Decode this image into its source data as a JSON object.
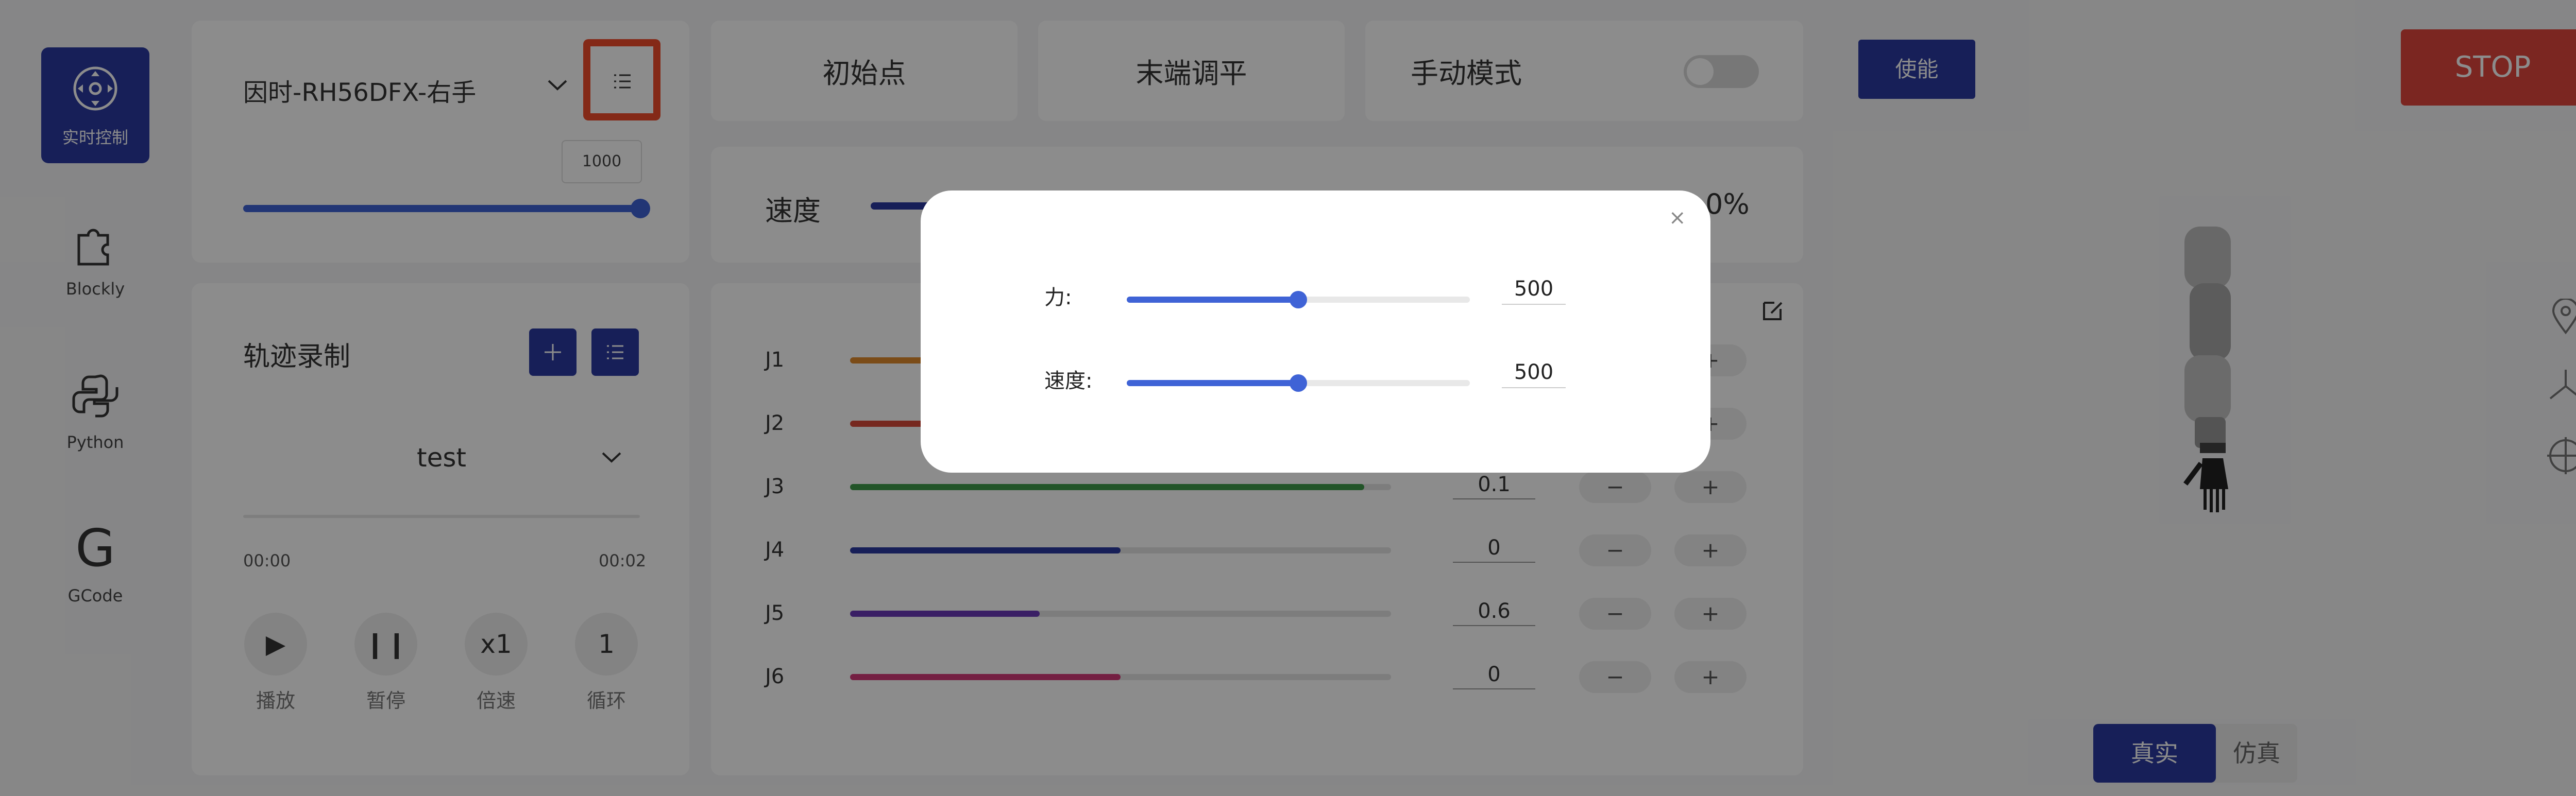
{
  "sidebar": {
    "items": [
      {
        "label": "实时控制",
        "icon": "joystick-icon",
        "active": true
      },
      {
        "label": "Blockly",
        "icon": "puzzle-icon",
        "active": false
      },
      {
        "label": "Python",
        "icon": "python-icon",
        "active": false
      },
      {
        "label": "GCode",
        "icon": "gcode-icon",
        "active": false
      }
    ]
  },
  "device": {
    "selected": "因时-RH56DFX-右手",
    "value_tooltip": "1000",
    "slider_value": 1000
  },
  "trajectory": {
    "title": "轨迹录制",
    "selected": "test",
    "time_start": "00:00",
    "time_end": "00:02",
    "controls": [
      {
        "symbol": "▶",
        "label": "播放",
        "icon": "play-icon"
      },
      {
        "symbol": "❙❙",
        "label": "暂停",
        "icon": "pause-icon"
      },
      {
        "symbol": "x1",
        "label": "倍速",
        "icon": "speed-icon"
      },
      {
        "symbol": "1",
        "label": "循环",
        "icon": "loop-icon"
      }
    ]
  },
  "tabs": {
    "initial": "初始点",
    "level": "末端调平",
    "manual": "手动模式",
    "manual_on": false
  },
  "speed": {
    "label": "速度",
    "percent_text": "0%"
  },
  "joints": [
    {
      "name": "J1",
      "color": "#e08a2c",
      "fill": 0.45,
      "value": ""
    },
    {
      "name": "J2",
      "color": "#d84a3a",
      "fill": 0.4,
      "value": ""
    },
    {
      "name": "J3",
      "color": "#3f9a4a",
      "fill": 0.95,
      "value": "0.1"
    },
    {
      "name": "J4",
      "color": "#2a3aa0",
      "fill": 0.5,
      "value": "0"
    },
    {
      "name": "J5",
      "color": "#6a3ab8",
      "fill": 0.35,
      "value": "0.6"
    },
    {
      "name": "J6",
      "color": "#d43a78",
      "fill": 0.5,
      "value": "0"
    }
  ],
  "joint_buttons": {
    "minus": "−",
    "plus": "+"
  },
  "right": {
    "enable": "使能",
    "stop": "STOP",
    "mode_real": "真实",
    "mode_sim": "仿真"
  },
  "modal": {
    "force_label": "力:",
    "force_value": "500",
    "force_fraction": 0.5,
    "speed_label": "速度:",
    "speed_value": "500",
    "speed_fraction": 0.5,
    "close": "×"
  },
  "colors": {
    "accent": "#2a3aa0",
    "stop": "#e0463c",
    "highlight": "#f04b2a",
    "slider": "#3f63d6"
  }
}
